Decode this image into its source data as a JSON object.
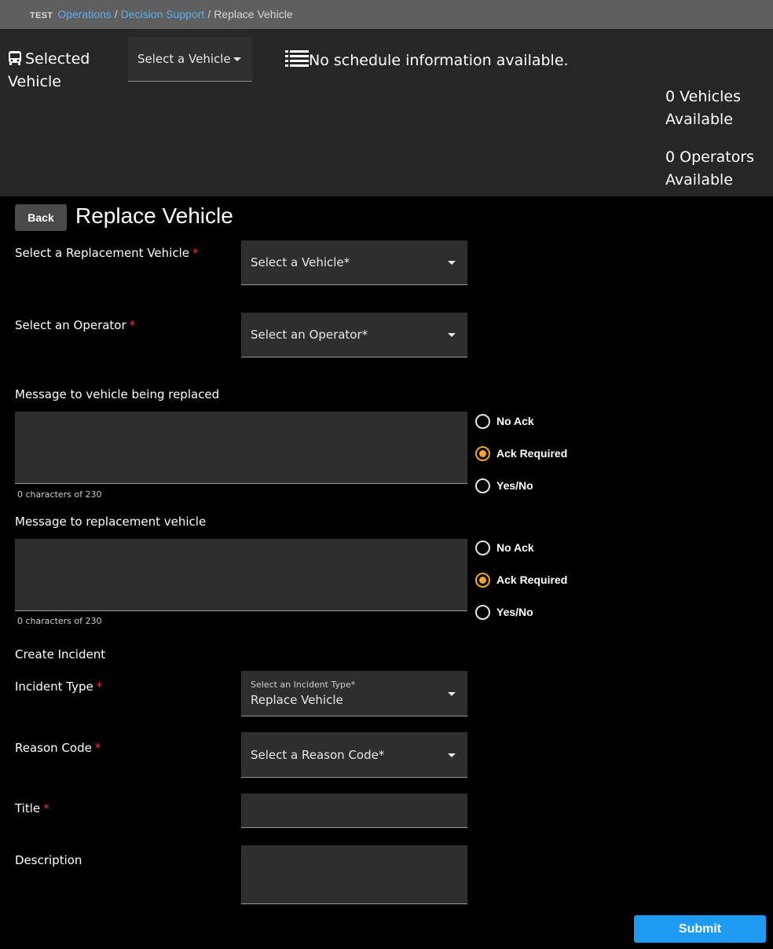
{
  "breadcrumb": {
    "env": "TEST",
    "items": [
      "Operations",
      "Decision Support",
      "Replace Vehicle"
    ],
    "separator": "/"
  },
  "header": {
    "selected_vehicle_label": "Selected Vehicle",
    "vehicle_select": "Select a Vehicle",
    "schedule_text": "No schedule information available.",
    "vehicles_available": "0 Vehicles Available",
    "operators_available": "0 Operators Available"
  },
  "page": {
    "back_label": "Back",
    "title": "Replace Vehicle"
  },
  "form": {
    "replacement_vehicle": {
      "label": "Select a Replacement Vehicle",
      "required_mark": "*",
      "placeholder": "Select a Vehicle*"
    },
    "operator": {
      "label": "Select an Operator",
      "required_mark": "*",
      "placeholder": "Select an Operator*"
    },
    "message_replaced": {
      "label": "Message to vehicle being replaced",
      "counter": "0 characters of 230",
      "options": [
        "No Ack",
        "Ack Required",
        "Yes/No"
      ],
      "selected": "Ack Required"
    },
    "message_replacement": {
      "label": "Message to replacement vehicle",
      "counter": "0 characters of 230",
      "options": [
        "No Ack",
        "Ack Required",
        "Yes/No"
      ],
      "selected": "Ack Required"
    },
    "create_incident_label": "Create Incident",
    "incident_type": {
      "label": "Incident Type",
      "required_mark": "*",
      "floating_label": "Select an Incident Type*",
      "value": "Replace Vehicle"
    },
    "reason_code": {
      "label": "Reason Code",
      "required_mark": "*",
      "placeholder": "Select a Reason Code*"
    },
    "title_field": {
      "label": "Title",
      "required_mark": "*"
    },
    "description_field": {
      "label": "Description"
    },
    "submit_label": "Submit"
  },
  "colors": {
    "accent_blue": "#1e9bf0",
    "link_blue": "#5aaef0",
    "radio_selected": "#f5a623",
    "required_red": "#e53935"
  }
}
